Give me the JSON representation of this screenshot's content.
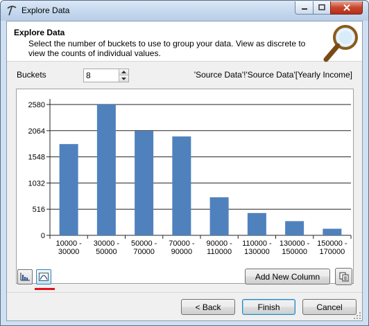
{
  "window": {
    "title": "Explore Data"
  },
  "header": {
    "title": "Explore Data",
    "description": "Select the number of buckets to use to group your data.  View as discrete to view the counts of individual values."
  },
  "buckets": {
    "label": "Buckets",
    "value": "8"
  },
  "source_label": "'Source Data'!'Source Data'[Yearly Income]",
  "buttons": {
    "add_new_column": "Add New Column",
    "back": "< Back",
    "finish": "Finish",
    "cancel": "Cancel"
  },
  "icons": {
    "window": "pickaxe-icon",
    "header": "magnifier-icon",
    "histogram_view": "histogram-icon",
    "discrete_view": "curve-icon",
    "copy": "copy-icon"
  },
  "colors": {
    "bar": "#4f81bd",
    "selection_underline": "#e0121a"
  },
  "chart_data": {
    "type": "bar",
    "categories": [
      [
        "10000 -",
        "30000"
      ],
      [
        "30000 -",
        "50000"
      ],
      [
        "50000 -",
        "70000"
      ],
      [
        "70000 -",
        "90000"
      ],
      [
        "90000 -",
        "110000"
      ],
      [
        "110000 -",
        "130000"
      ],
      [
        "130000 -",
        "150000"
      ],
      [
        "150000 -",
        "170000"
      ]
    ],
    "values": [
      1800,
      2580,
      2060,
      1950,
      750,
      440,
      280,
      130
    ],
    "yticks": [
      "0",
      "516",
      "1032",
      "1548",
      "2064",
      "2580"
    ],
    "ytick_values": [
      0,
      516,
      1032,
      1548,
      2064,
      2580
    ],
    "ylim": [
      0,
      2580
    ],
    "grid": true
  }
}
